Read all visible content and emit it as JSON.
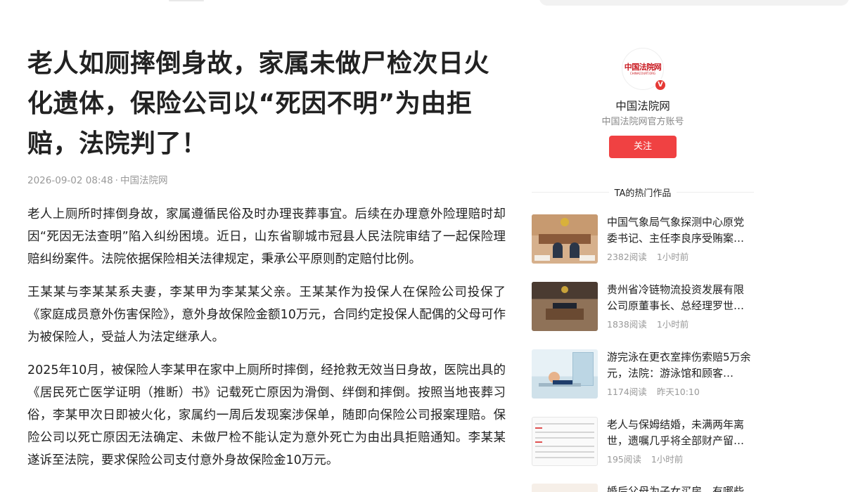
{
  "article": {
    "title": "老人如厕摔倒身故，家属未做尸检次日火化遗体，保险公司以“死因不明”为由拒赔，法院判了！",
    "date": "2026-09-02 08:48",
    "meta_separator": "·",
    "source": "中国法院网",
    "paragraphs": [
      "老人上厕所时摔倒身故，家属遵循民俗及时办理丧葬事宜。后续在办理意外险理赔时却因“死因无法查明”陷入纠纷困境。近日，山东省聊城市冠县人民法院审结了一起保险理赔纠纷案件。法院依据保险相关法律规定，秉承公平原则酌定赔付比例。",
      "王某某与李某某系夫妻，李某甲为李某某父亲。王某某作为投保人在保险公司投保了《家庭成员意外伤害保险》，意外身故保险金额10万元，合同约定投保人配偶的父母可作为被保险人，受益人为法定继承人。",
      "2025年10月，被保险人李某甲在家中上厕所时摔倒，经抢救无效当日身故，医院出具的《居民死亡医学证明（推断）书》记载死亡原因为滑倒、绊倒和摔倒。按照当地丧葬习俗，李某甲次日即被火化，家属约一周后发现案涉保单，随即向保险公司报案理赔。保险公司以死亡原因无法确定、未做尸检不能认定为意外死亡为由出具拒赔通知。李某某遂诉至法院，要求保险公司支付意外身故保险金10万元。"
    ]
  },
  "author": {
    "avatar_logo": "中国法院网",
    "avatar_sub": "CHINACOURT.ORG",
    "verified_badge": "V",
    "name": "中国法院网",
    "description": "中国法院网官方账号",
    "follow_label": "关注"
  },
  "hot_works": {
    "heading": "TA的热门作品",
    "items": [
      {
        "title": "中国气象局气象探测中心原党委书记、主任李良序受贿案…",
        "reads": "2382阅读",
        "time": "1小时前",
        "thumb": "courtroom-trial-thumbnail"
      },
      {
        "title": "贵州省冷链物流投资发展有限公司原董事长、总经理罗世…",
        "reads": "1838阅读",
        "time": "1小时前",
        "thumb": "courtroom-wide-thumbnail"
      },
      {
        "title": "游完泳在更衣室摔伤索赔5万余元，法院：游泳馆和顾客…",
        "reads": "1174阅读",
        "time": "昨天10:10",
        "thumb": "locker-room-illustration-thumbnail"
      },
      {
        "title": "老人与保姆结婚，未满两年离世，遗嘱几乎将全部财产留…",
        "reads": "195阅读",
        "time": "1小时前",
        "thumb": "document-table-thumbnail"
      }
    ],
    "peek_title": "婚后父母为子女买房，有哪些"
  }
}
